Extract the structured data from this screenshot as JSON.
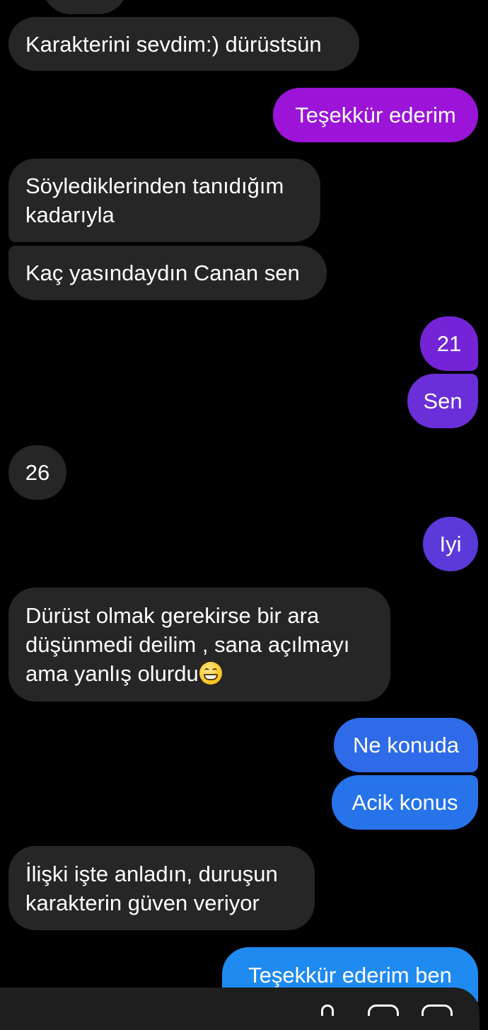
{
  "conversation": {
    "messages": [
      {
        "id": "m1",
        "direction": "received",
        "text": "Karakterini sevdim:) dürüstsün"
      },
      {
        "id": "m2",
        "direction": "sent",
        "text": "Teşekkür ederim",
        "color": "#9b14d8"
      },
      {
        "id": "m3",
        "direction": "received",
        "lines": [
          "Söylediklerinden tanıdığım",
          "kadarıyla"
        ]
      },
      {
        "id": "m4",
        "direction": "received",
        "text": "Kaç yasındaydın Canan sen"
      },
      {
        "id": "m5",
        "direction": "sent",
        "text": "21",
        "color": "#7424d6"
      },
      {
        "id": "m6",
        "direction": "sent",
        "text": "Sen",
        "color": "#6a2fd8"
      },
      {
        "id": "m7",
        "direction": "received",
        "text": "26"
      },
      {
        "id": "m8",
        "direction": "sent",
        "text": "Iyi",
        "color": "#5a3ad8"
      },
      {
        "id": "m9",
        "direction": "received",
        "lines": [
          "Dürüst olmak gerekirse bir ara",
          "düşünmedi deilim , sana açılmayı",
          "ama yanlış olurdu"
        ],
        "trailing_emoji": "grinning-face-with-smiling-eyes"
      },
      {
        "id": "m10",
        "direction": "sent",
        "text": "Ne konuda",
        "color": "#2f6be8"
      },
      {
        "id": "m11",
        "direction": "sent",
        "text": "Acik konus",
        "color": "#2673ea"
      },
      {
        "id": "m12",
        "direction": "received",
        "lines": [
          "İlişki işte anladın, duruşun",
          "karakterin güven veriyor"
        ]
      },
      {
        "id": "m13",
        "direction": "sent",
        "text": "Teşekkür ederim ben",
        "color": "#1f8af0"
      }
    ]
  },
  "colors": {
    "background": "#000000",
    "received_bubble": "#262626",
    "text": "#ffffff",
    "composer_bar": "#1e1e1e"
  },
  "composer": {
    "icons": [
      "microphone-icon",
      "gallery-icon",
      "sticker-icon"
    ]
  }
}
